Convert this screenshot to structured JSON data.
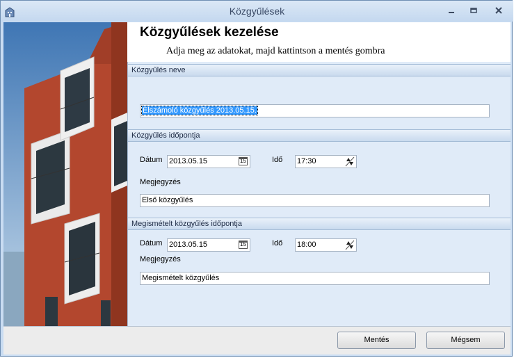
{
  "window": {
    "title": "Közgyűlések"
  },
  "header": {
    "title": "Közgyűlések kezelése",
    "subtitle": "Adja meg az adatokat, majd kattintson a mentés gombra"
  },
  "sections": {
    "name": {
      "title": "Közgyűlés neve",
      "value": "Elszámoló közgyűlés 2013.05.15."
    },
    "first": {
      "title": "Közgyűlés időpontja",
      "date_label": "Dátum",
      "date_value": "2013.05.15",
      "time_label": "Idő",
      "time_value": "17:30",
      "note_label": "Megjegyzés",
      "note_value": "Első közgyűlés"
    },
    "repeat": {
      "title": "Megismételt közgyűlés időpontja",
      "date_label": "Dátum",
      "date_value": "2013.05.15",
      "time_label": "Idő",
      "time_value": "18:00",
      "note_label": "Megjegyzés",
      "note_value": "Megismételt közgyűlés"
    }
  },
  "calendar_icon_text": "15",
  "buttons": {
    "save": "Mentés",
    "cancel": "Mégsem"
  },
  "icons": {
    "app": "building-icon",
    "minimize": "minimize-icon",
    "maximize": "maximize-icon",
    "close": "close-icon",
    "calendar": "calendar-icon",
    "spinner": "spinner-updown-icon"
  },
  "colors": {
    "section_header": "#c9daee",
    "form_background": "#e0ebf8",
    "selection": "#3399ff"
  }
}
